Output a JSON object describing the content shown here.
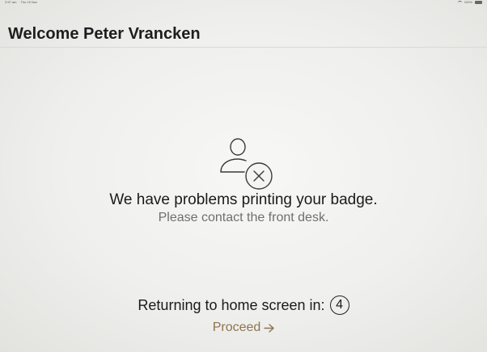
{
  "status_bar": {
    "time": "2:57 am",
    "date": "Thu 19 Nov",
    "battery": "100%"
  },
  "header": {
    "title": "Welcome Peter Vrancken"
  },
  "error": {
    "icon": "user-error-icon",
    "message": "We have problems printing your badge.",
    "subtext": "Please contact the front desk."
  },
  "countdown": {
    "label": "Returning to home screen in:",
    "seconds": "4"
  },
  "proceed": {
    "label": "Proceed",
    "icon": "arrow-right-icon",
    "color": "#8e7450"
  }
}
